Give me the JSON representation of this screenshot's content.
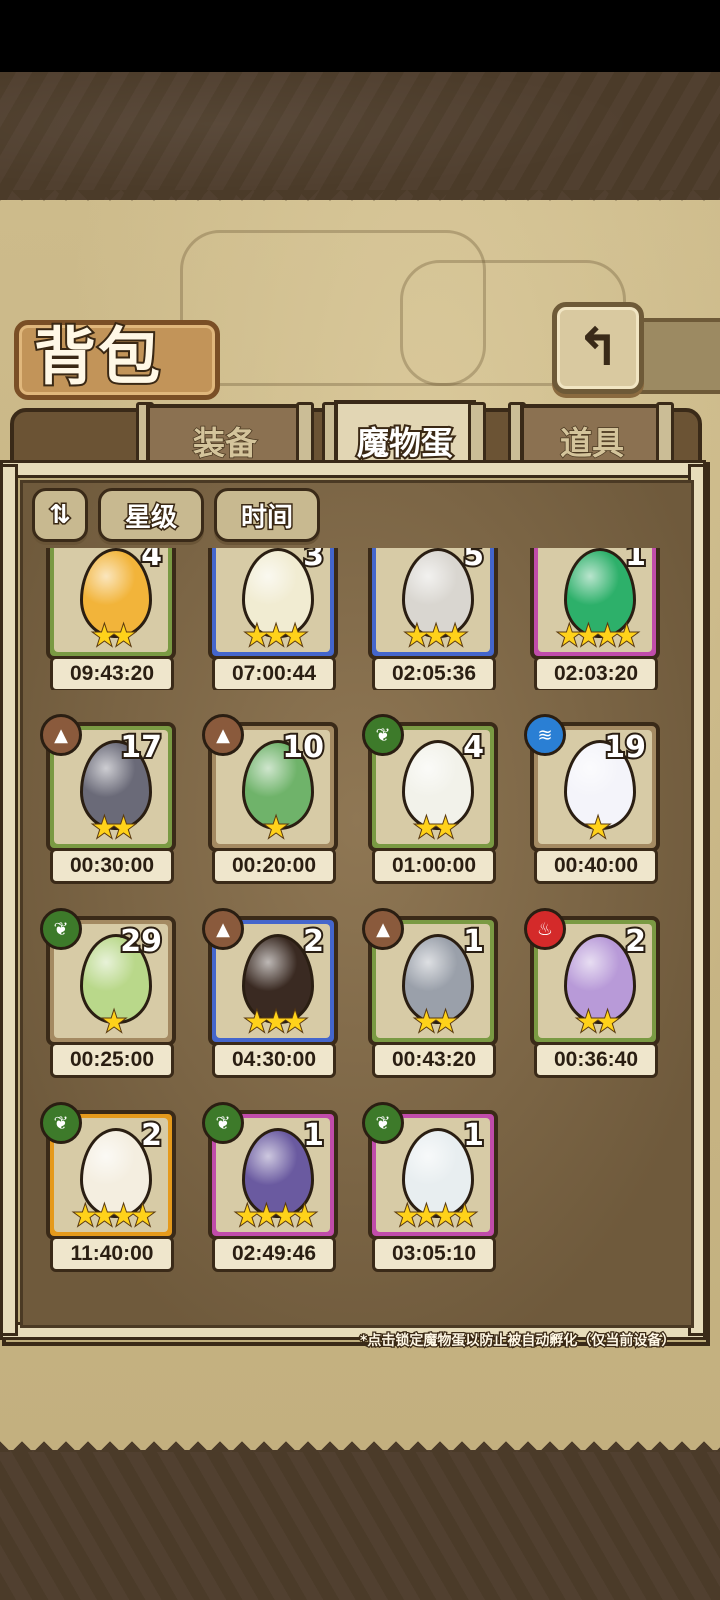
{
  "title": "背包",
  "back_icon": "↰",
  "tabs": [
    {
      "label": "装备",
      "active": false
    },
    {
      "label": "魔物蛋",
      "active": true
    },
    {
      "label": "道具",
      "active": false
    }
  ],
  "filters": {
    "sort_icon": "⇅",
    "star_label": "星级",
    "time_label": "时间"
  },
  "eggs": [
    {
      "count": "4",
      "stars": "★★",
      "timer": "09:43:20",
      "rarity": "green",
      "egg_color": "#f2b43a",
      "element": ""
    },
    {
      "count": "3",
      "stars": "★★★",
      "timer": "07:00:44",
      "rarity": "blue",
      "egg_color": "#f1ecd2",
      "element": ""
    },
    {
      "count": "5",
      "stars": "★★★",
      "timer": "02:05:36",
      "rarity": "blue",
      "egg_color": "#d9d6d0",
      "element": ""
    },
    {
      "count": "1",
      "stars": "★★★★",
      "timer": "02:03:20",
      "rarity": "pink",
      "egg_color": "#2db06a",
      "element": ""
    },
    {
      "count": "17",
      "stars": "★★",
      "timer": "00:30:00",
      "rarity": "green",
      "egg_color": "#6a6a78",
      "element": "earth"
    },
    {
      "count": "10",
      "stars": "★",
      "timer": "00:20:00",
      "rarity": "plain",
      "egg_color": "#6fb36a",
      "element": "earth"
    },
    {
      "count": "4",
      "stars": "★★",
      "timer": "01:00:00",
      "rarity": "green",
      "egg_color": "#f2f2ea",
      "element": "grass"
    },
    {
      "count": "19",
      "stars": "★",
      "timer": "00:40:00",
      "rarity": "plain",
      "egg_color": "#f4f4fa",
      "element": "water"
    },
    {
      "count": "29",
      "stars": "★",
      "timer": "00:25:00",
      "rarity": "plain",
      "egg_color": "#b9d88a",
      "element": "grass"
    },
    {
      "count": "2",
      "stars": "★★★",
      "timer": "04:30:00",
      "rarity": "blue",
      "egg_color": "#3a2a22",
      "element": "earth"
    },
    {
      "count": "1",
      "stars": "★★",
      "timer": "00:43:20",
      "rarity": "green",
      "egg_color": "#9aa0aa",
      "element": "earth"
    },
    {
      "count": "2",
      "stars": "★★",
      "timer": "00:36:40",
      "rarity": "green",
      "egg_color": "#b89ad8",
      "element": "fire"
    },
    {
      "count": "2",
      "stars": "★★★★",
      "timer": "11:40:00",
      "rarity": "gold",
      "egg_color": "#f4eee0",
      "element": "grass"
    },
    {
      "count": "1",
      "stars": "★★★★",
      "timer": "02:49:46",
      "rarity": "pink",
      "egg_color": "#6a5aa0",
      "element": "grass"
    },
    {
      "count": "1",
      "stars": "★★★★",
      "timer": "03:05:10",
      "rarity": "pink",
      "egg_color": "#e8eef0",
      "element": "grass"
    }
  ],
  "element_icons": {
    "grass": "❦",
    "earth": "▲",
    "water": "≋",
    "fire": "♨"
  },
  "note": "*点击锁定魔物蛋以防止被自动孵化（仅当前设备）"
}
